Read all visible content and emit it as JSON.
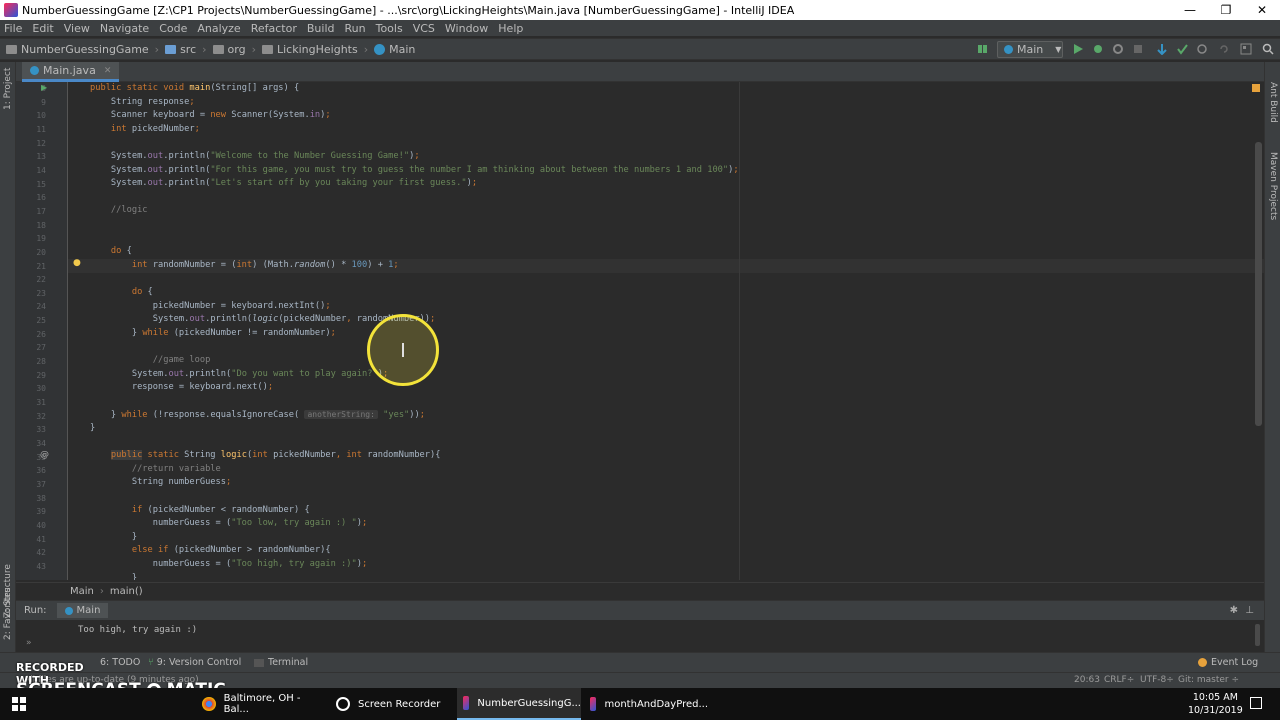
{
  "window": {
    "title": "NumberGuessingGame [Z:\\CP1 Projects\\NumberGuessingGame] - ...\\src\\org\\LickingHeights\\Main.java [NumberGuessingGame] - IntelliJ IDEA",
    "minimize": "—",
    "maximize": "❐",
    "close": "✕"
  },
  "menu": [
    "File",
    "Edit",
    "View",
    "Navigate",
    "Code",
    "Analyze",
    "Refactor",
    "Build",
    "Run",
    "Tools",
    "VCS",
    "Window",
    "Help"
  ],
  "navbar": {
    "crumbs": [
      "NumberGuessingGame",
      "src",
      "org",
      "LickingHeights",
      "Main"
    ],
    "run_config": "Main"
  },
  "tabs": [
    {
      "label": "Main.java",
      "close": "✕"
    }
  ],
  "left_stripe": {
    "project": "1: Project",
    "structure": "Z: Structure",
    "favorites": "2: Favorites"
  },
  "right_stripe": {
    "ant": "Ant Build",
    "maven": "Maven Projects"
  },
  "editor": {
    "line_numbers": [
      "8",
      "9",
      "10",
      "11",
      "12",
      "13",
      "14",
      "15",
      "16",
      "17",
      "18",
      "19",
      "20",
      "21",
      "22",
      "23",
      "24",
      "25",
      "26",
      "27",
      "28",
      "29",
      "30",
      "31",
      "32",
      "33",
      "34",
      "35",
      "36",
      "37",
      "38",
      "39",
      "40",
      "41",
      "42",
      "43"
    ],
    "param_hint": "anotherString:"
  },
  "breadcrumb": {
    "class": "Main",
    "method": "main()"
  },
  "run_panel": {
    "label": "Run:",
    "tab": "Main",
    "output": "Too high, try again :)"
  },
  "bottom_tools": {
    "todo": "6: TODO",
    "vcs": "9: Version Control",
    "terminal": "Terminal",
    "event_log": "Event Log"
  },
  "status": {
    "message": "All files are up-to-date (9 minutes ago)",
    "position": "20:63",
    "line_sep": "CRLF÷",
    "encoding": "UTF-8÷",
    "git": "Git: master ÷"
  },
  "watermark": {
    "line1": "RECORDED WITH",
    "line2": "SCREENCAST",
    "line3": "MATIC"
  },
  "taskbar": {
    "items": [
      "Baltimore, OH - Bal...",
      "Screen Recorder",
      "NumberGuessingG...",
      "monthAndDayPred..."
    ],
    "time": "10:05 AM",
    "date": "10/31/2019"
  }
}
